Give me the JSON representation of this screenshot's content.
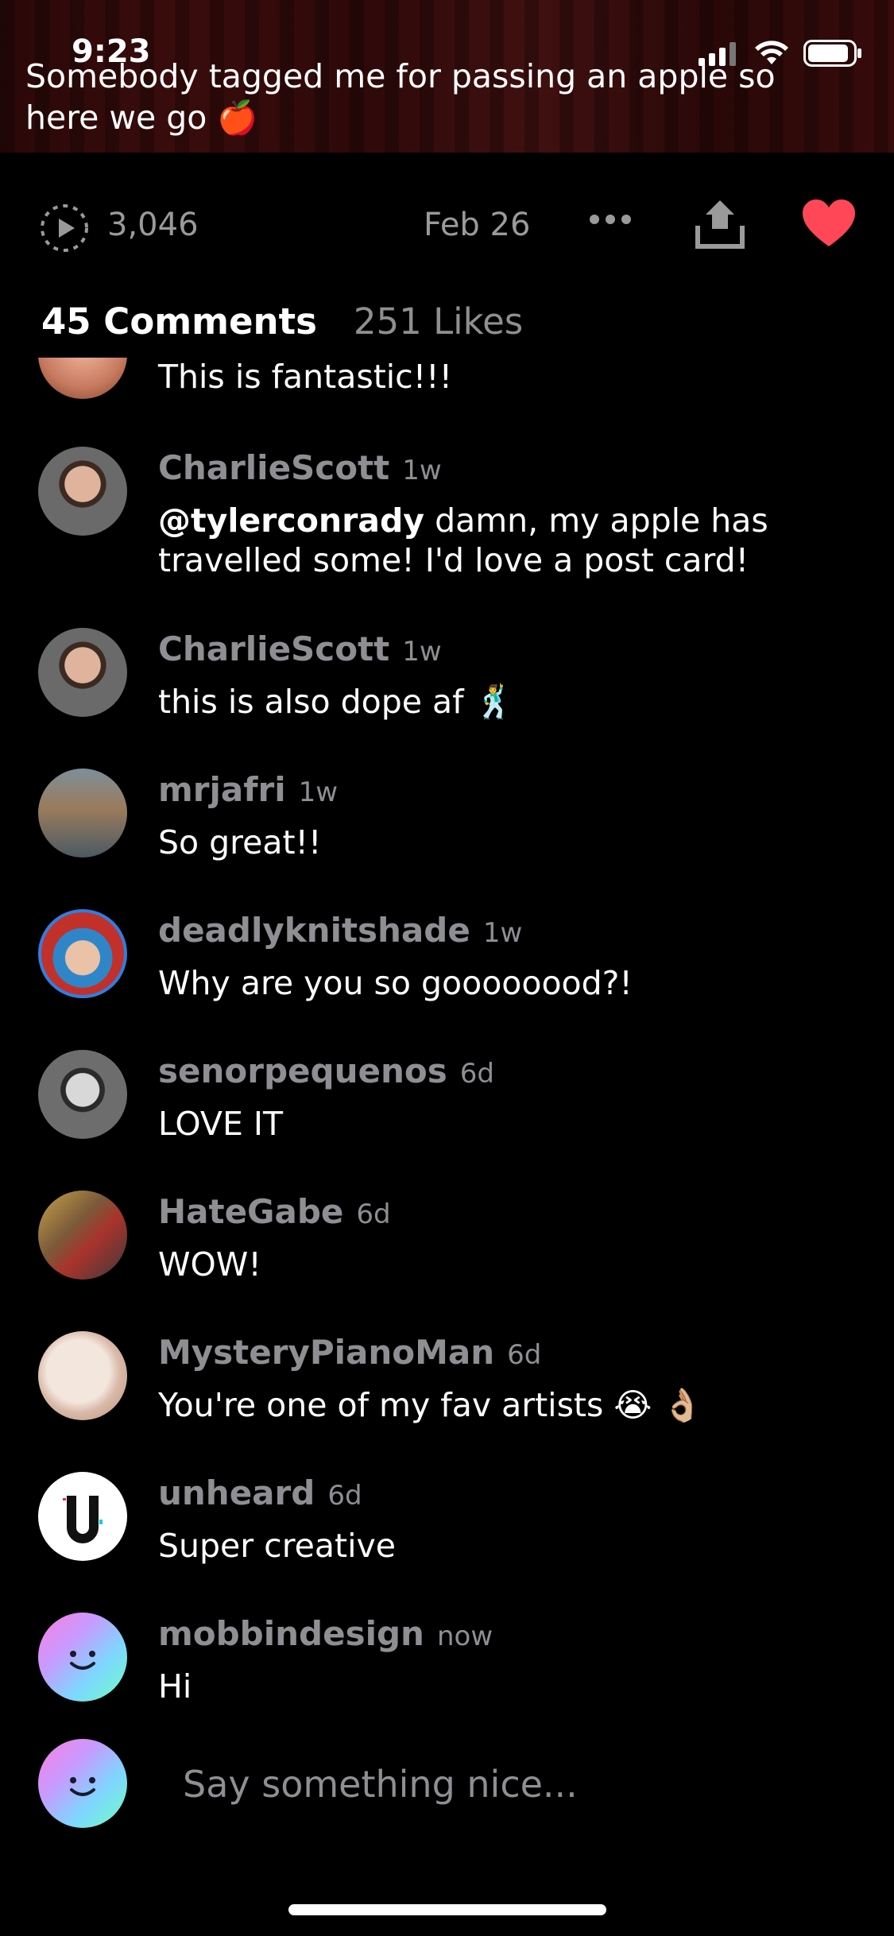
{
  "status_bar": {
    "time": "9:23"
  },
  "post": {
    "caption": "Somebody tagged me for passing an apple so here we go 🍎",
    "views": "3,046",
    "date": "Feb 26"
  },
  "tabs": {
    "comments": "45 Comments",
    "likes": "251 Likes"
  },
  "partial_comment": {
    "text": "This is fantastic!!!"
  },
  "comments": [
    {
      "user": "CharlieScott",
      "time": "1w",
      "mention": "@tylerconrady",
      "text": " damn, my apple has travelled some!  I'd love a post card!"
    },
    {
      "user": "CharlieScott",
      "time": "1w",
      "text": "this is also dope af 🕺"
    },
    {
      "user": "mrjafri",
      "time": "1w",
      "text": "So great!!"
    },
    {
      "user": "deadlyknitshade",
      "time": "1w",
      "text": "Why are you so goooooood?!"
    },
    {
      "user": "senorpequenos",
      "time": "6d",
      "text": "LOVE IT"
    },
    {
      "user": "HateGabe",
      "time": "6d",
      "text": "WOW!"
    },
    {
      "user": "MysteryPianoMan",
      "time": "6d",
      "text": "You're one of my fav artists 😭 👌🏼"
    },
    {
      "user": "unheard",
      "time": "6d",
      "text": "Super creative"
    },
    {
      "user": "mobbindesign",
      "time": "now",
      "text": "Hi"
    }
  ],
  "input": {
    "placeholder": "Say something nice..."
  },
  "colors": {
    "background": "#000000",
    "heart": "#ff4757",
    "muted": "#8e8e93"
  },
  "icons": [
    "play-views-icon",
    "more-icon",
    "share-icon",
    "heart-icon",
    "signal-icon",
    "wifi-icon",
    "battery-icon"
  ]
}
